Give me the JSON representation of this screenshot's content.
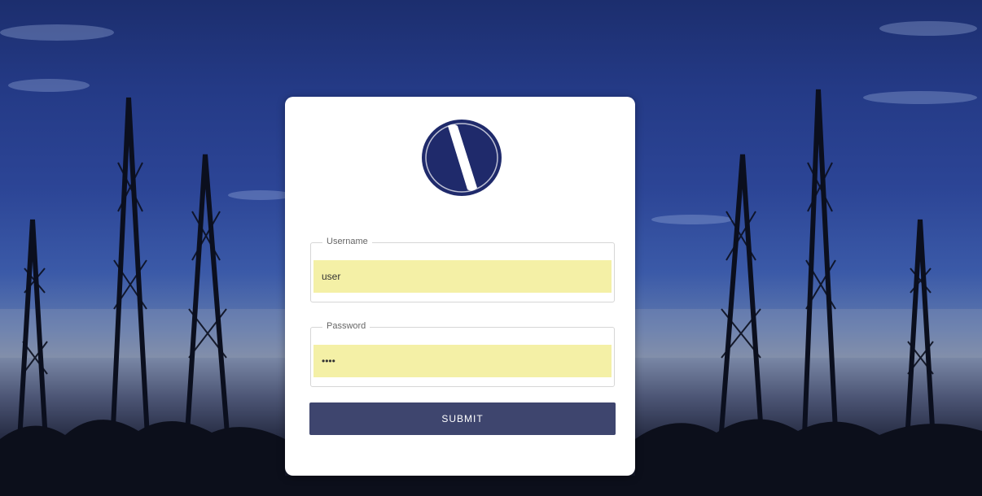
{
  "header": {
    "title": ""
  },
  "login": {
    "username_label": "Username",
    "username_value": "user",
    "password_label": "Password",
    "password_value": "••••",
    "submit_label": "SUBMIT"
  },
  "colors": {
    "accent": "#3e456e",
    "autofill": "#f4f0a6",
    "logo": "#1f2a6b"
  },
  "icons": {
    "logo": "logo-icon"
  }
}
